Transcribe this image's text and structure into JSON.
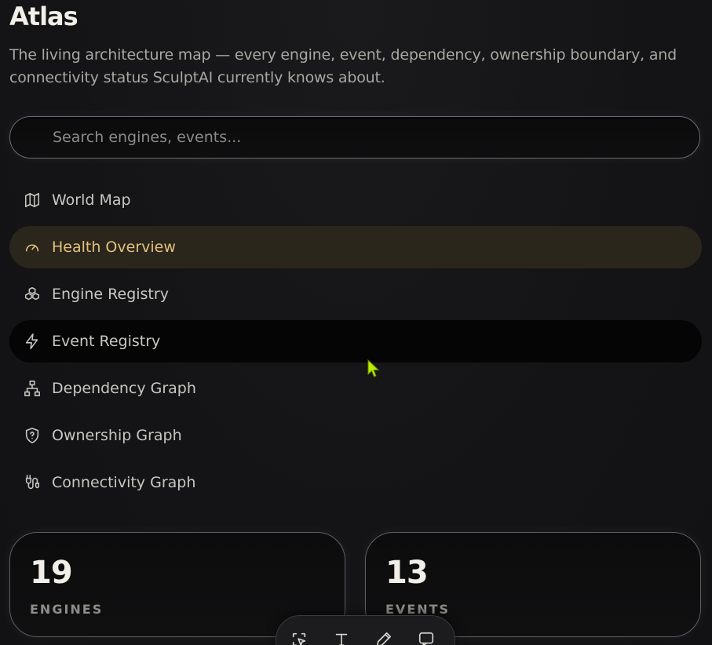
{
  "header": {
    "title": "Atlas",
    "subtitle": "The living architecture map — every engine, event, dependency, ownership boundary, and connectivity status SculptAI currently knows about."
  },
  "search": {
    "placeholder": "Search engines, events..."
  },
  "nav": {
    "items": [
      {
        "label": "World Map",
        "icon": "map-icon"
      },
      {
        "label": "Health Overview",
        "icon": "gauge-icon",
        "active": true
      },
      {
        "label": "Engine Registry",
        "icon": "boxes-icon"
      },
      {
        "label": "Event Registry",
        "icon": "bolt-icon"
      },
      {
        "label": "Dependency Graph",
        "icon": "network-icon"
      },
      {
        "label": "Ownership Graph",
        "icon": "shield-question-icon"
      },
      {
        "label": "Connectivity Graph",
        "icon": "plug-icon"
      }
    ]
  },
  "stats": {
    "engines": {
      "value": "19",
      "label": "ENGINES"
    },
    "events": {
      "value": "13",
      "label": "EVENTS"
    }
  },
  "toolbar": {
    "tools": [
      "select-icon",
      "text-icon",
      "pen-icon",
      "comment-icon"
    ]
  },
  "colors": {
    "background": "#151517",
    "active_accent": "#e2c27d",
    "active_bg": "#2a261c",
    "cursor": "#b8f000"
  }
}
